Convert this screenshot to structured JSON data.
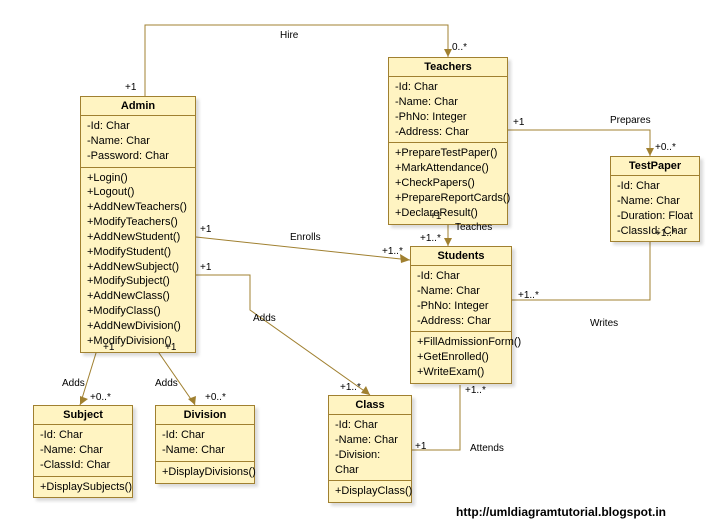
{
  "classes": {
    "admin": {
      "title": "Admin",
      "attrs": [
        "-Id: Char",
        "-Name: Char",
        "-Password: Char"
      ],
      "ops": [
        "+Login()",
        "+Logout()",
        "+AddNewTeachers()",
        "+ModifyTeachers()",
        "+AddNewStudent()",
        "+ModifyStudent()",
        "+AddNewSubject()",
        "+ModifySubject()",
        "+AddNewClass()",
        "+ModifyClass()",
        "+AddNewDivision()",
        "+ModifyDivision()"
      ]
    },
    "teachers": {
      "title": "Teachers",
      "attrs": [
        "-Id: Char",
        "-Name: Char",
        "-PhNo: Integer",
        "-Address: Char"
      ],
      "ops": [
        "+PrepareTestPaper()",
        "+MarkAttendance()",
        "+CheckPapers()",
        "+PrepareReportCards()",
        "+DeclareResult()"
      ]
    },
    "students": {
      "title": "Students",
      "attrs": [
        "-Id: Char",
        "-Name: Char",
        "-PhNo: Integer",
        "-Address: Char"
      ],
      "ops": [
        "+FillAdmissionForm()",
        "+GetEnrolled()",
        "+WriteExam()"
      ]
    },
    "testpaper": {
      "title": "TestPaper",
      "attrs": [
        "-Id: Char",
        "-Name: Char",
        "-Duration: Float",
        "-ClassId: Char"
      ],
      "ops": []
    },
    "subject": {
      "title": "Subject",
      "attrs": [
        "-Id: Char",
        "-Name: Char",
        "-ClassId: Char"
      ],
      "ops": [
        "+DisplaySubjects()"
      ]
    },
    "division": {
      "title": "Division",
      "attrs": [
        "-Id: Char",
        "-Name: Char"
      ],
      "ops": [
        "+DisplayDivisions()"
      ]
    },
    "class": {
      "title": "Class",
      "attrs": [
        "-Id: Char",
        "-Name: Char",
        "-Division: Char"
      ],
      "ops": [
        "+DisplayClass()"
      ]
    }
  },
  "labels": {
    "hire": "Hire",
    "prepares": "Prepares",
    "teaches": "Teaches",
    "enrolls": "Enrolls",
    "writes": "Writes",
    "attends": "Attends",
    "adds1": "Adds",
    "adds2": "Adds",
    "adds3": "Adds",
    "m_plus1_a": "+1",
    "m_plus1_b": "+1",
    "m_plus1_c": "+1",
    "m_plus1_d": "+1",
    "m_plus1_e": "+1",
    "m_plus1_f": "+1",
    "m_plus1_g": "+1",
    "m_plus1_h": "+1",
    "m0s_a": "0..*",
    "m0s_b": "+0..*",
    "m0s_c": "+0..*",
    "m0s_d": "+0..*",
    "m1s_a": "+1..*",
    "m1s_b": "+1..*",
    "m1s_c": "+1..*",
    "m1s_d": "+1..*",
    "m1s_e": "+1..*"
  },
  "footer": "http://umldiagramtutorial.blogspot.in"
}
